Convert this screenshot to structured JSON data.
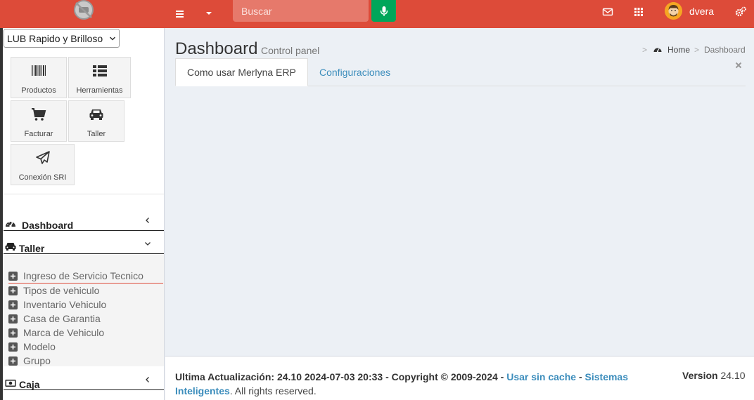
{
  "header": {
    "search_placeholder": "Buscar",
    "username": "dvera",
    "colors": {
      "bar": "#dd4b39",
      "mic": "#00a65a"
    }
  },
  "sidebar": {
    "company": "LUB Rapido y Brilloso",
    "tiles": [
      {
        "label": "Productos",
        "icon": "barcode-icon"
      },
      {
        "label": "Herramientas",
        "icon": "list-icon"
      },
      {
        "label": "Facturar",
        "icon": "cart-icon"
      },
      {
        "label": "Taller",
        "icon": "car-icon"
      },
      {
        "label": "Conexión SRI",
        "icon": "paper-plane-icon"
      }
    ],
    "menu": [
      {
        "label": "Dashboard",
        "icon": "dashboard-icon"
      },
      {
        "label": "Taller",
        "icon": "car-icon"
      },
      {
        "label": "Caja",
        "icon": "money-icon"
      }
    ],
    "taller_items": [
      "Ingreso de Servicio Tecnico",
      "Tipos de vehiculo",
      "Inventario Vehiculo",
      "Casa de Garantia",
      "Marca de Vehiculo",
      "Modelo",
      "Grupo"
    ]
  },
  "content": {
    "title": "Dashboard",
    "subtitle": "Control panel",
    "breadcrumb": {
      "home": "Home",
      "current": "Dashboard"
    },
    "tabs": [
      "Como usar Merlyna ERP",
      "Configuraciones"
    ]
  },
  "footer": {
    "prefix": "Ultima Actualización: 24.10 2024-07-03 20:33 - Copyright © 2009-2024 -",
    "link_cache": "Usar sin cache",
    "sep": "-",
    "link_company": "Sistemas Inteligentes",
    "suffix": ". All rights reserved.",
    "version_label": "Version",
    "version_value": "24.10"
  }
}
